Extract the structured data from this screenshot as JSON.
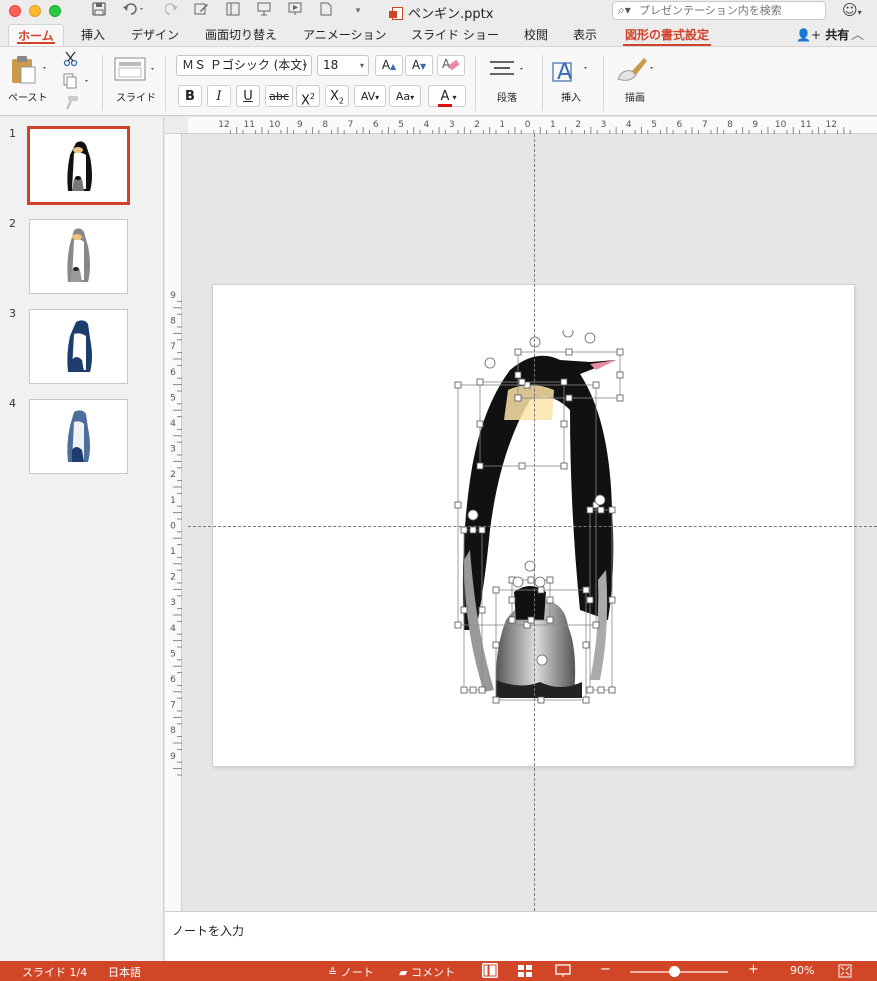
{
  "window": {
    "filename": "ペンギン.pptx",
    "search_placeholder": "プレゼンテーション内を検索"
  },
  "tabs": [
    {
      "label": "ホーム",
      "active": true
    },
    {
      "label": "挿入"
    },
    {
      "label": "デザイン"
    },
    {
      "label": "画面切り替え"
    },
    {
      "label": "アニメーション"
    },
    {
      "label": "スライド ショー"
    },
    {
      "label": "校閲"
    },
    {
      "label": "表示"
    },
    {
      "label": "図形の書式設定",
      "contextual": true
    }
  ],
  "share_label": "共有",
  "ribbon": {
    "paste_label": "ペースト",
    "slide_label": "スライド",
    "font_name": "ＭＳ Ｐゴシック (本文)",
    "font_size": "18",
    "grow_font": "A",
    "shrink_font": "A",
    "bold": "B",
    "italic": "I",
    "underline": "U",
    "strike": "abc",
    "superscript": "X",
    "subscript": "X",
    "spacing": "AV",
    "case": "Aa",
    "font_color": "A",
    "paragraph_label": "段落",
    "insert_label": "挿入",
    "draw_label": "描画",
    "font_color_hex": "#e01010"
  },
  "slides": [
    {
      "number": "1",
      "selected": true,
      "color": "black"
    },
    {
      "number": "2",
      "color": "gray"
    },
    {
      "number": "3",
      "color": "navy"
    },
    {
      "number": "4",
      "color": "navy-light"
    }
  ],
  "ruler": {
    "h_ticks": [
      "12",
      "11",
      "10",
      "9",
      "8",
      "7",
      "6",
      "5",
      "4",
      "3",
      "2",
      "1",
      "0",
      "1",
      "2",
      "3",
      "4",
      "5",
      "6",
      "7",
      "8",
      "9",
      "10",
      "11",
      "12"
    ],
    "v_ticks": [
      "9",
      "8",
      "7",
      "6",
      "5",
      "4",
      "3",
      "2",
      "1",
      "0",
      "1",
      "2",
      "3",
      "4",
      "5",
      "6",
      "7",
      "8",
      "9"
    ]
  },
  "notes_placeholder": "ノートを入力",
  "status": {
    "slide_counter": "スライド 1/4",
    "language": "日本語",
    "notes_label": "ノート",
    "comments_label": "コメント",
    "zoom_minus": "−",
    "zoom_plus": "+",
    "zoom_level": "90%",
    "zoom_fraction": 0.45
  },
  "colors": {
    "accent": "#d0432a",
    "status_bar": "#d24628"
  }
}
